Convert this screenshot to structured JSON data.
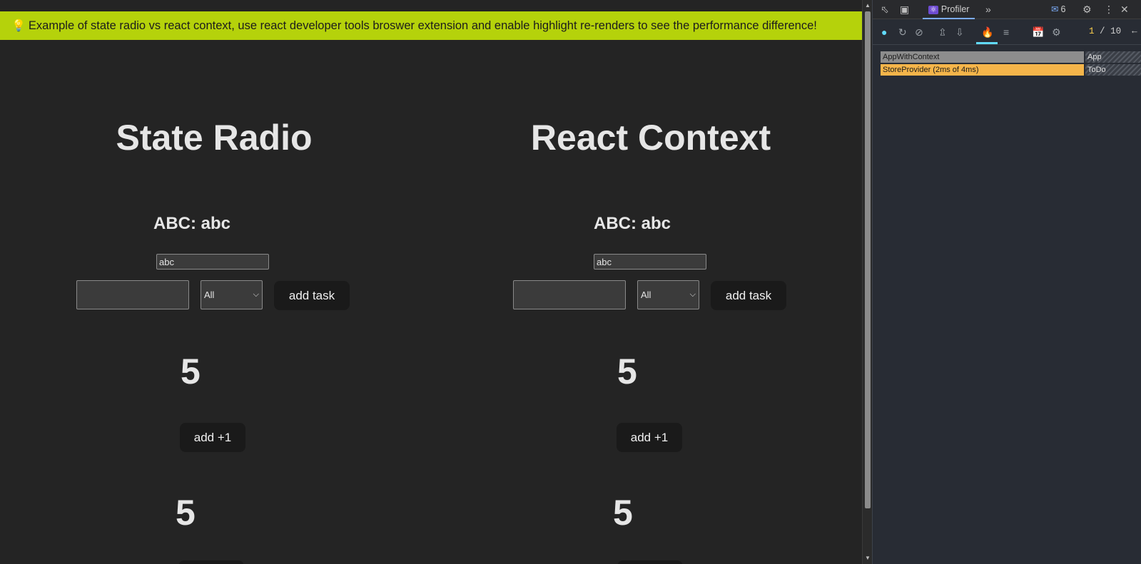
{
  "banner": {
    "icon": "lightbulb-icon",
    "icon_glyph": "💡",
    "text": "Example of state radio vs react context, use react developer tools broswer extension and enable highlight re-renders to see the performance difference!"
  },
  "columns": [
    {
      "title": "State Radio",
      "abc_label": "ABC: abc",
      "abc_input_value": "abc",
      "task_input_value": "",
      "filter_selected": "All",
      "add_task_label": "add task",
      "count_1": "5",
      "add_one_label": "add +1",
      "count_2": "5"
    },
    {
      "title": "React Context",
      "abc_label": "ABC: abc",
      "abc_input_value": "abc",
      "task_input_value": "",
      "filter_selected": "All",
      "add_task_label": "add task",
      "count_1": "5",
      "add_one_label": "add +1",
      "count_2": "5"
    }
  ],
  "devtools": {
    "tab_label": "Profiler",
    "messages_count": "6",
    "commit_current": "1",
    "commit_separator": "/",
    "commit_total": "10",
    "flame": [
      {
        "name": "AppWithContext",
        "child_name": "App"
      },
      {
        "name": "StoreProvider (2ms of 4ms)",
        "child_name": "ToDo"
      }
    ]
  },
  "colors": {
    "banner_bg": "#b5d20b",
    "page_bg": "#242424",
    "devtools_bg": "#282c34",
    "flame_grey": "#8d8d8d",
    "flame_orange": "#f5b54a",
    "accent": "#61dafb"
  }
}
